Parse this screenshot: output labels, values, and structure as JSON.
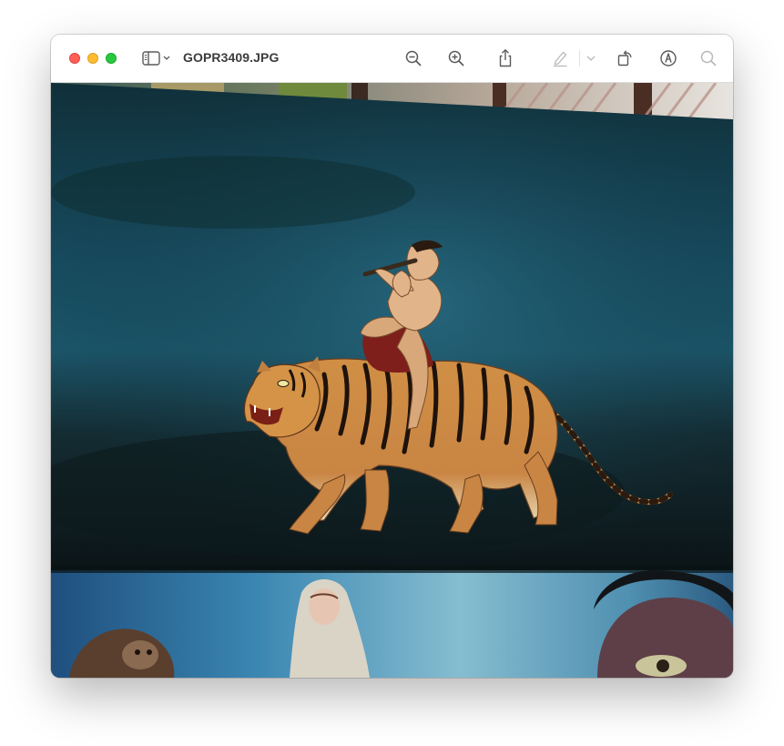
{
  "window": {
    "title": "GOPR3409.JPG"
  },
  "toolbar": {
    "buttons": [
      {
        "name": "sidebar-toggle-icon"
      },
      {
        "name": "zoom-out-icon"
      },
      {
        "name": "zoom-in-icon"
      },
      {
        "name": "share-icon"
      },
      {
        "name": "highlight-pen-icon"
      },
      {
        "name": "markup-chevron-down-icon"
      },
      {
        "name": "rotate-icon"
      },
      {
        "name": "markup-icon"
      },
      {
        "name": "search-icon"
      }
    ]
  },
  "colors": {
    "close": "#ff5f57",
    "minimize": "#febc2e",
    "zoom": "#28c840",
    "icon": "#5a5a5a",
    "icon_disabled": "#b9b9b9"
  }
}
